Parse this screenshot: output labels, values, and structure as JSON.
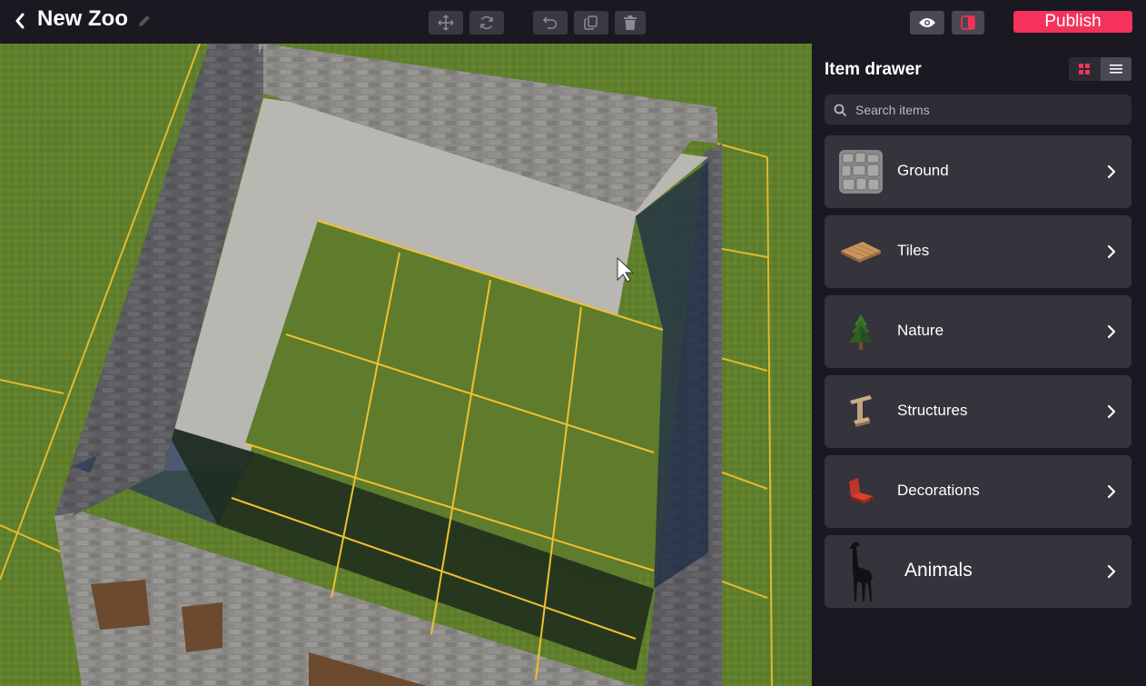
{
  "header": {
    "title": "New Zoo",
    "publish_label": "Publish"
  },
  "toolbar": {
    "icons": [
      "move-icon",
      "rotate-icon",
      "undo-icon",
      "copy-icon",
      "delete-icon",
      "eye-icon",
      "panel-icon"
    ]
  },
  "drawer": {
    "title": "Item drawer",
    "search_placeholder": "Search items",
    "view_mode": "grid",
    "categories": [
      {
        "label": "Ground",
        "icon": "stone-ground-thumb"
      },
      {
        "label": "Tiles",
        "icon": "wood-tile-thumb"
      },
      {
        "label": "Nature",
        "icon": "pine-tree-thumb"
      },
      {
        "label": "Structures",
        "icon": "wooden-post-thumb"
      },
      {
        "label": "Decorations",
        "icon": "red-chair-thumb"
      },
      {
        "label": "Animals",
        "icon": "giraffe-thumb"
      }
    ]
  },
  "colors": {
    "accent": "#f4325b",
    "panel": "#1a1820",
    "card": "#35333c",
    "grid_line": "#f0c030"
  }
}
